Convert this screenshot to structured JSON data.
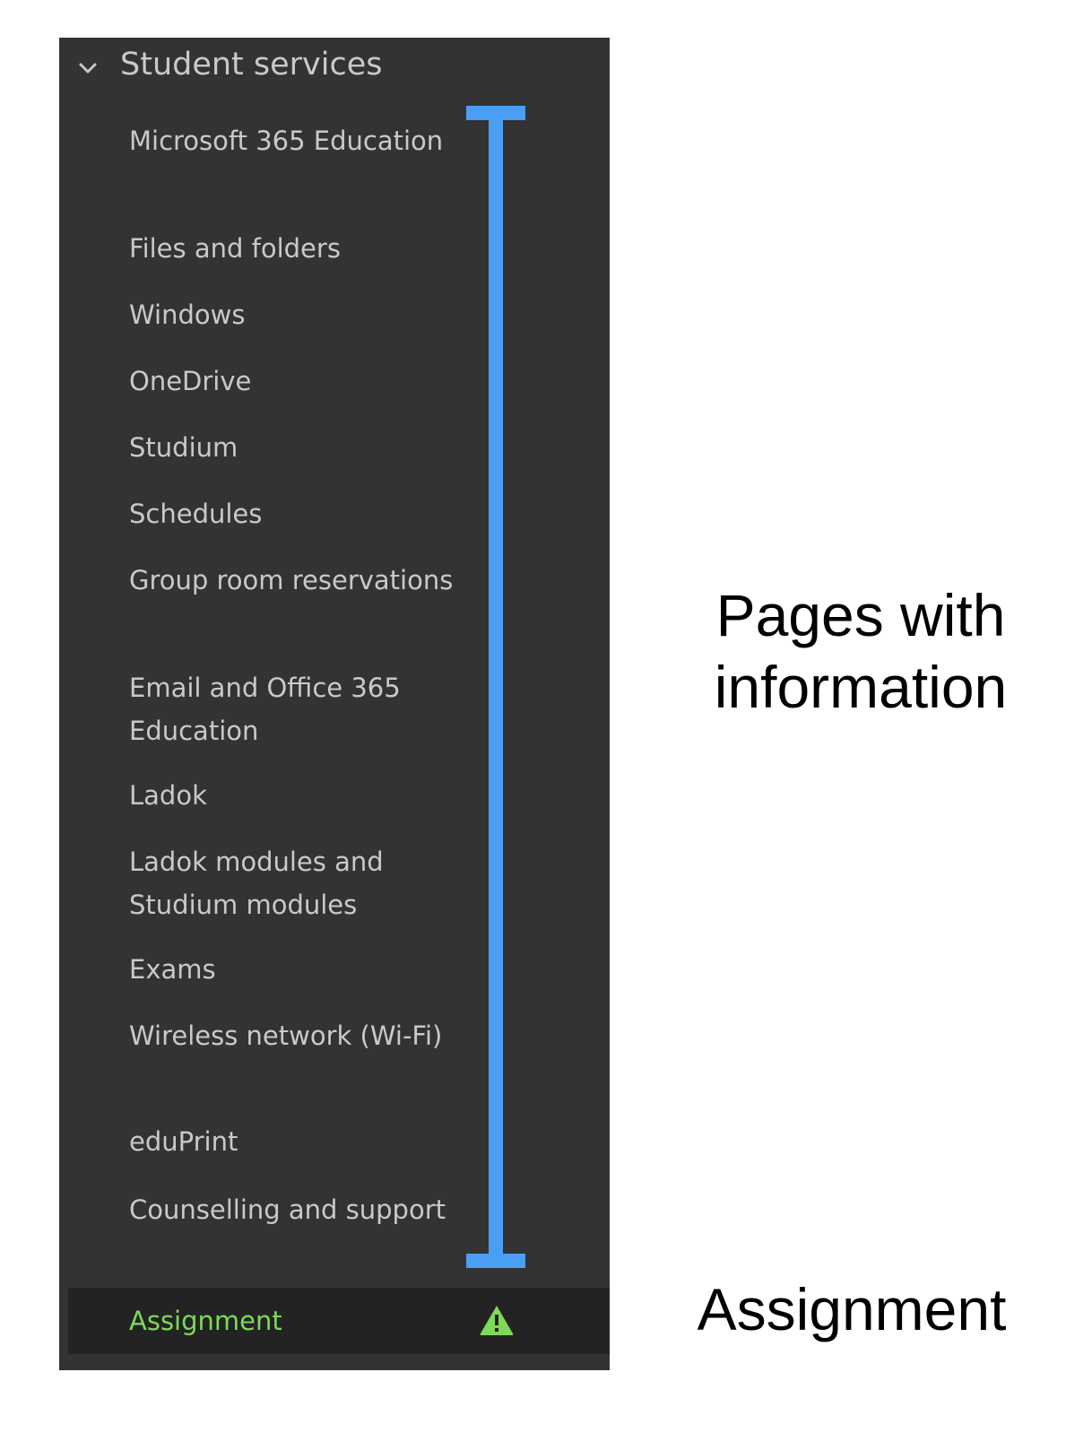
{
  "sidebar": {
    "section_title": "Student services",
    "items": [
      {
        "label": "Microsoft 365 Education"
      },
      {
        "label": "Files and folders"
      },
      {
        "label": "Windows"
      },
      {
        "label": "OneDrive"
      },
      {
        "label": "Studium"
      },
      {
        "label": "Schedules"
      },
      {
        "label": "Group room reservations"
      },
      {
        "label": "Email and Office 365 Education"
      },
      {
        "label": "Ladok"
      },
      {
        "label": "Ladok modules and Studium modules"
      },
      {
        "label": "Exams"
      },
      {
        "label": "Wireless network (Wi-Fi)"
      },
      {
        "label": "eduPrint"
      },
      {
        "label": "Counselling and support"
      }
    ],
    "active_item": {
      "label": "Assignment",
      "icon": "warning-icon",
      "color": "#7ed957"
    },
    "background_color": "#333333"
  },
  "annotations": {
    "pages_label": "Pages with information",
    "assignment_label": "Assignment",
    "bracket_color": "#4a9ff5"
  }
}
